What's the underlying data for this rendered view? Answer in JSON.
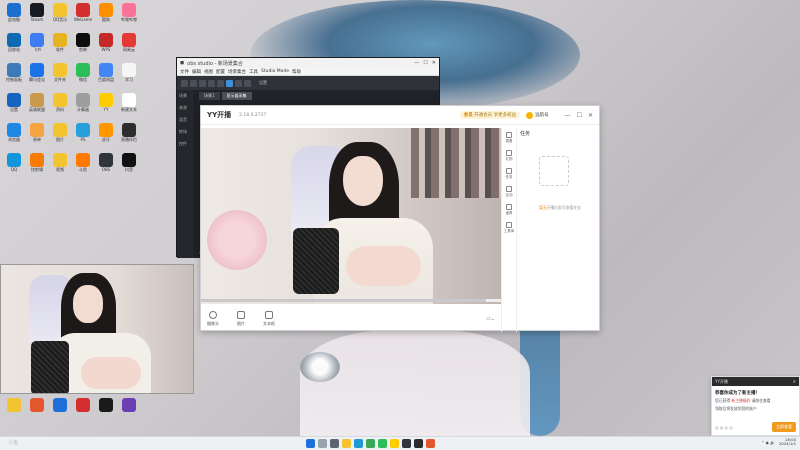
{
  "obs": {
    "title": "obs studio - 新场景集合",
    "menu": [
      "文件",
      "编辑",
      "视图",
      "配置",
      "场景集合",
      "工具",
      "Studio Mode",
      "帮助"
    ],
    "toolbar_text": "设置",
    "left_items": [
      "场景",
      "来源",
      "混音",
      "转场",
      "控件"
    ],
    "tabs": [
      "场景1",
      "显示器采集"
    ],
    "dots": "◀◀◀"
  },
  "yy": {
    "logo": "YY开播",
    "version": "2.18.0.2737",
    "vip_prefix": "会员",
    "vip_text": "开通会员 享更多权益",
    "user": "远航号",
    "min_glyph": "—",
    "max_glyph": "☐",
    "close_glyph": "✕",
    "progress": 0.95,
    "controls": [
      {
        "label": "摄像头"
      },
      {
        "label": "图片"
      },
      {
        "label": "文本框"
      }
    ],
    "right_ctrl": "▭⌄",
    "rail": [
      "观看",
      "礼物",
      "任务",
      "互动",
      "道具",
      "工具库"
    ],
    "panel_title": "任务",
    "empty_prefix": "暂无",
    "empty_text": "开播后即可查看任务"
  },
  "notify": {
    "head": "YY开播",
    "close": "✕",
    "title": "恭喜你成为了新主播！",
    "line1_a": "您已获得",
    "line1_b": "新主播福利",
    "line1_c": "请前往查看",
    "line2": "领取后将发放到您的账户",
    "icons": "◎ ◎ ◎ ◎",
    "button": "立即查看"
  },
  "taskbar": {
    "watermark": "斗鱼",
    "time": "18:00",
    "date": "2024/1/1",
    "tray": "⌃ ◉ 🔊"
  },
  "desktop": {
    "icons": [
      "此电脑",
      "Steam",
      "QQ音乐",
      "WeGame",
      "酷狗",
      "哔哩哔哩",
      "回收站",
      "飞书",
      "软件",
      "剪映",
      "WPS",
      "网易云",
      "控制面板",
      "腾讯会议",
      "文件夹",
      "微信",
      "百度网盘",
      "学习",
      "设置",
      "英雄联盟",
      "资料",
      "计算器",
      "YY",
      "新建文本",
      "浏览器",
      "原神",
      "图片",
      "PS",
      "虎牙",
      "直播伴侣",
      "QQ",
      "快剪辑",
      "视频",
      "斗鱼",
      "OBS",
      "抖音"
    ]
  },
  "colors": {
    "accent": "#3c8fd8",
    "vip": "#d97a00",
    "notify_button": "#f29a1c"
  }
}
